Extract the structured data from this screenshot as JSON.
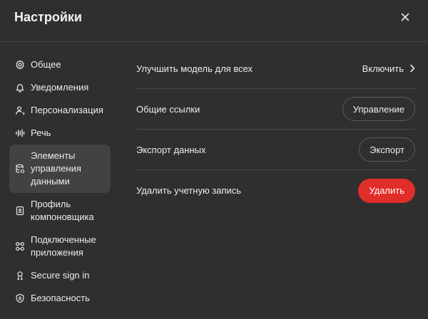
{
  "header": {
    "title": "Настройки"
  },
  "sidebar": {
    "items": [
      {
        "label": "Общее",
        "icon": "gear-icon"
      },
      {
        "label": "Уведомления",
        "icon": "bell-icon"
      },
      {
        "label": "Персонализация",
        "icon": "person-icon"
      },
      {
        "label": "Речь",
        "icon": "waveform-icon"
      },
      {
        "label": "Элементы\nуправления\nданными",
        "icon": "database-icon",
        "active": true
      },
      {
        "label": "Профиль\nкомпоновщика",
        "icon": "id-card-icon"
      },
      {
        "label": "Подключенные\nприложения",
        "icon": "apps-icon"
      },
      {
        "label": "Secure sign in",
        "icon": "key-icon"
      },
      {
        "label": "Безопасность",
        "icon": "shield-icon"
      }
    ]
  },
  "main": {
    "improve_model": {
      "label": "Улучшить модель для всех",
      "value": "Включить"
    },
    "shared_links": {
      "label": "Общие ссылки",
      "button": "Управление"
    },
    "export_data": {
      "label": "Экспорт данных",
      "button": "Экспорт"
    },
    "delete_account": {
      "label": "Удалить учетную запись",
      "button": "Удалить"
    }
  },
  "colors": {
    "background": "#2f2f2f",
    "active_item": "#424242",
    "danger": "#e02e2a",
    "divider": "#474747"
  }
}
